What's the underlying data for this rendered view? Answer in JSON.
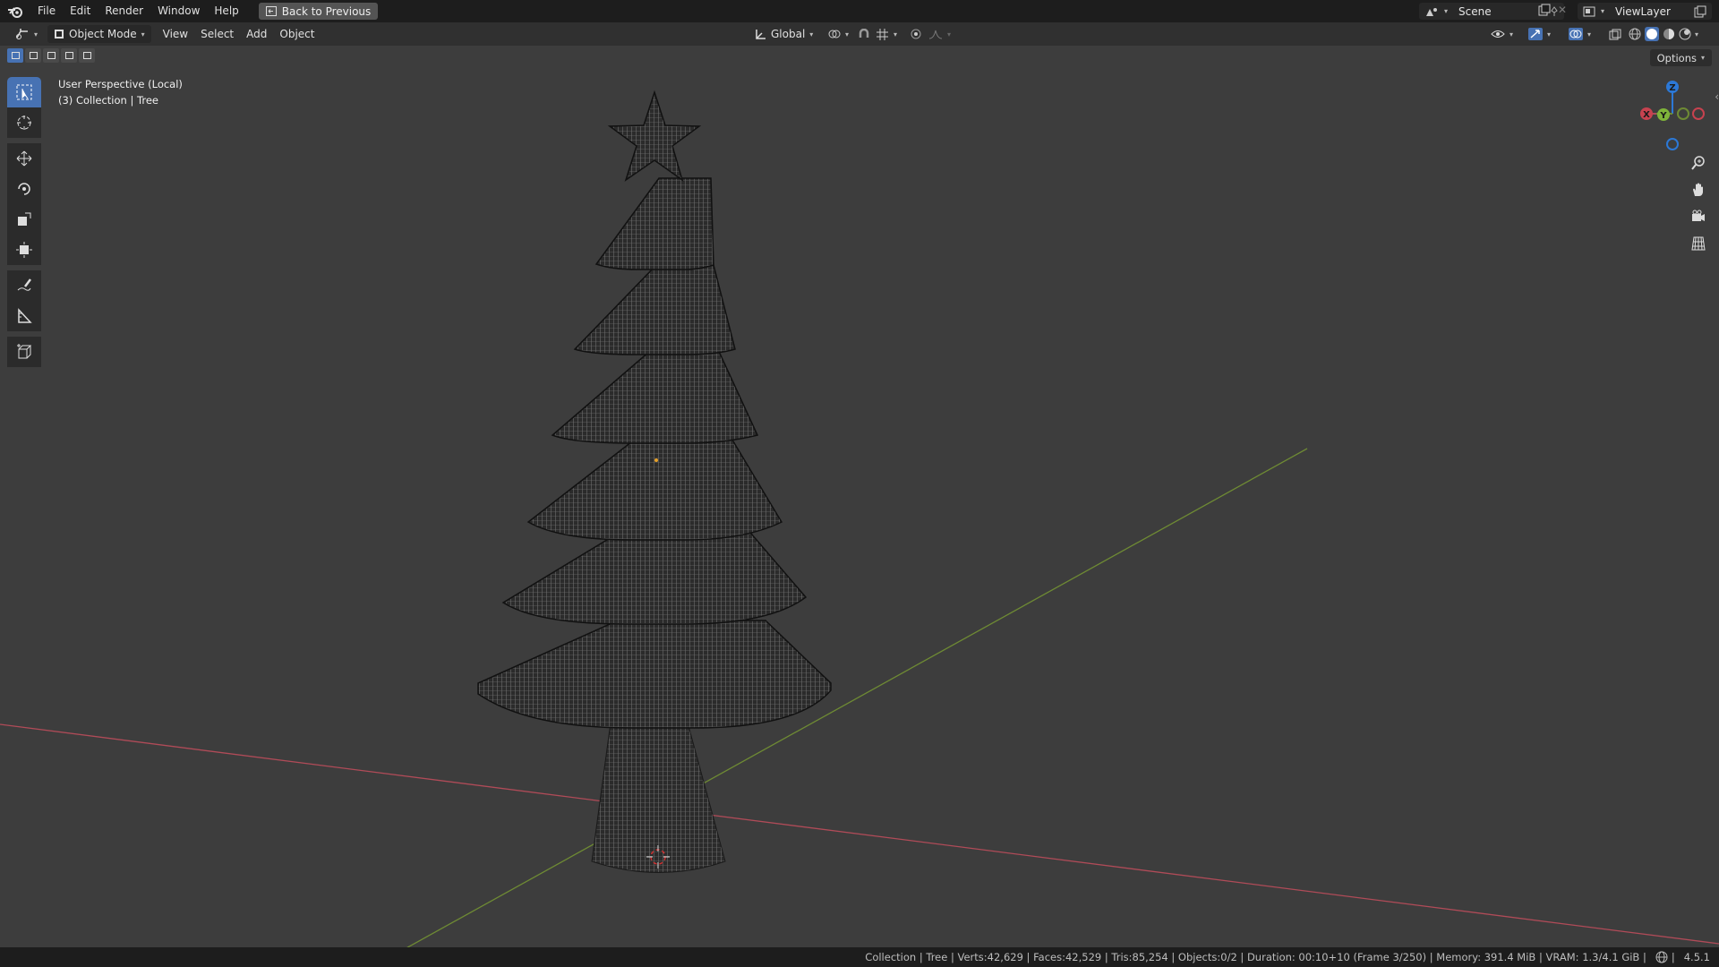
{
  "topbar": {
    "menu": [
      "File",
      "Edit",
      "Render",
      "Window",
      "Help"
    ],
    "back_label": "Back to Previous",
    "scene_label": "Scene",
    "view_layer_label": "ViewLayer"
  },
  "header": {
    "mode_label": "Object Mode",
    "menus": [
      "View",
      "Select",
      "Add",
      "Object"
    ],
    "orientation_label": "Global"
  },
  "viewport": {
    "perspective_label": "User Perspective (Local)",
    "collection_label": "(3) Collection | Tree",
    "options_label": "Options",
    "gizmo": {
      "x": "X",
      "y": "Y",
      "z": "Z"
    },
    "colors": {
      "x_axis": "#b04b58",
      "y_axis": "#6e8a34",
      "z_axis": "#2c78d6",
      "background": "#3d3d3d"
    }
  },
  "toolbar": {
    "tools": [
      "select-box-icon",
      "cursor-icon",
      "move-icon",
      "rotate-icon",
      "scale-icon",
      "transform-icon",
      "annotate-icon",
      "measure-icon",
      "add-cube-icon"
    ]
  },
  "statusbar": {
    "text": "Collection | Tree | Verts:42,629 | Faces:42,529 | Tris:85,254 | Objects:0/2 | Duration: 00:10+10 (Frame 3/250) | Memory: 391.4 MiB | VRAM: 1.3/4.1 GiB |",
    "version": "4.5.1"
  }
}
